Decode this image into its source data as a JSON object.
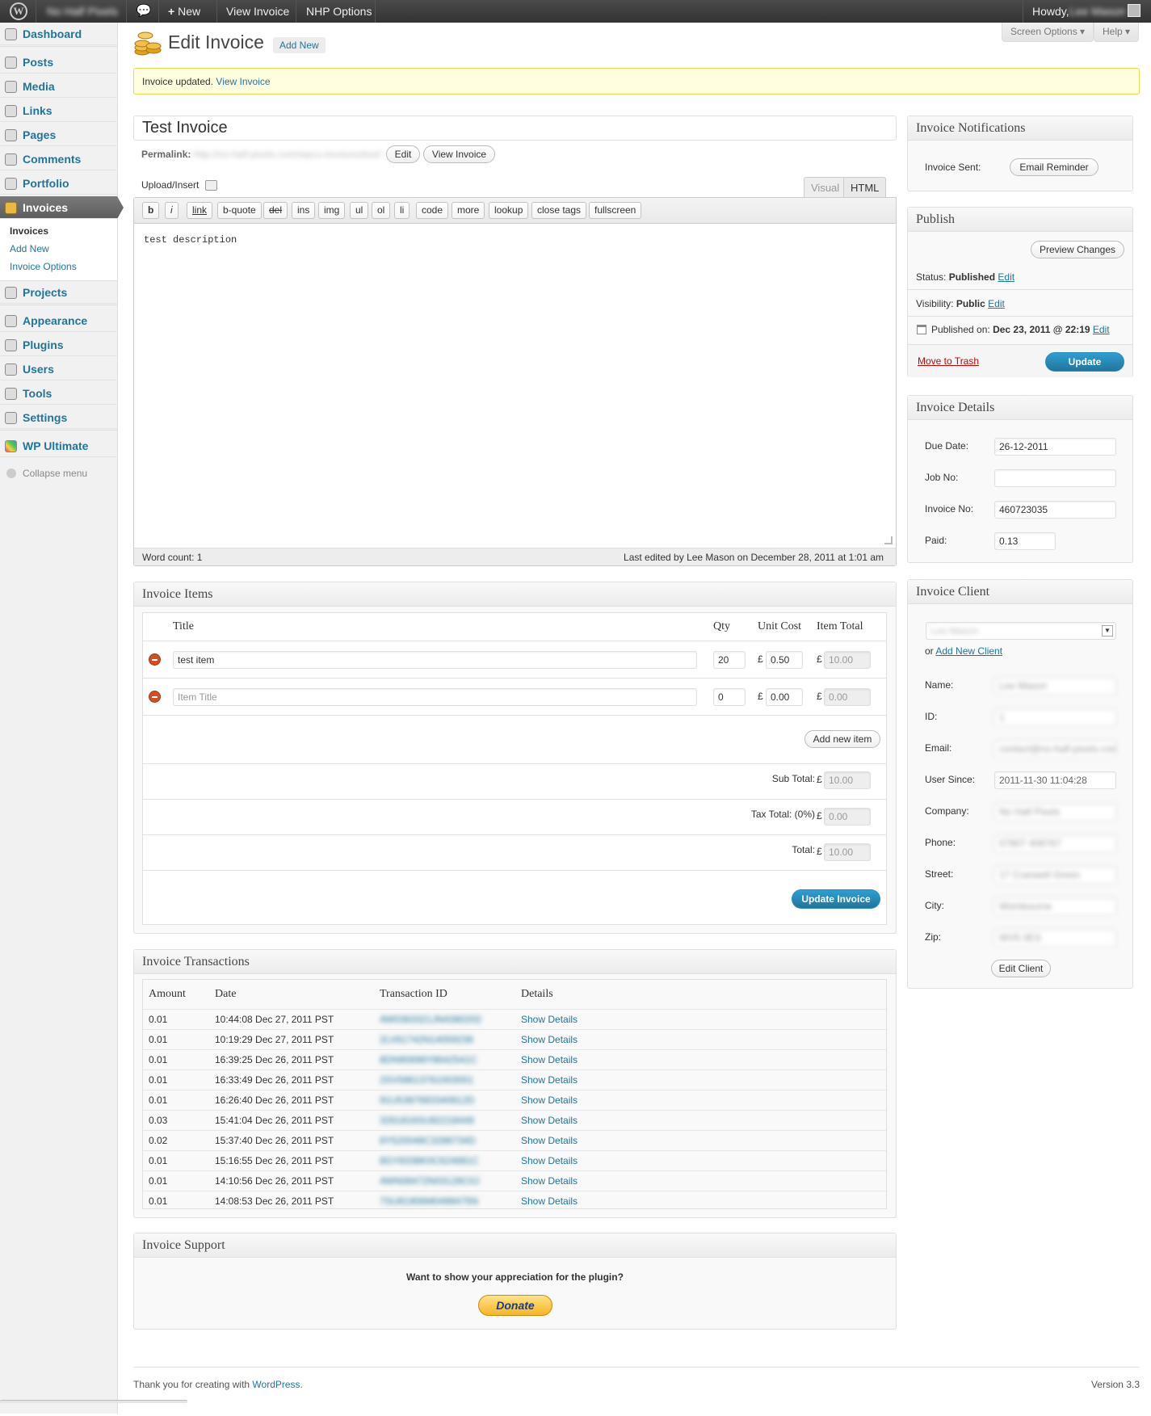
{
  "adminbar": {
    "site_name": "No Half Pixels",
    "new_label": "New",
    "view_invoice": "View Invoice",
    "nhp_options": "NHP Options",
    "howdy": "Howdy,",
    "user_name": "Lee Mason"
  },
  "sidebar": {
    "items": [
      {
        "label": "Dashboard"
      },
      {
        "label": "Posts"
      },
      {
        "label": "Media"
      },
      {
        "label": "Links"
      },
      {
        "label": "Pages"
      },
      {
        "label": "Comments"
      },
      {
        "label": "Portfolio"
      },
      {
        "label": "Invoices"
      },
      {
        "label": "Projects"
      },
      {
        "label": "Appearance"
      },
      {
        "label": "Plugins"
      },
      {
        "label": "Users"
      },
      {
        "label": "Tools"
      },
      {
        "label": "Settings"
      },
      {
        "label": "WP Ultimate"
      }
    ],
    "submenu": [
      "Invoices",
      "Add New",
      "Invoice Options"
    ],
    "collapse": "Collapse menu"
  },
  "header": {
    "title": "Edit Invoice",
    "add_new": "Add New",
    "screen_options": "Screen Options ▾",
    "help": "Help ▾"
  },
  "notice": {
    "text": "Invoice updated.",
    "link": "View Invoice"
  },
  "post": {
    "title": "Test Invoice",
    "permalink_label": "Permalink:",
    "permalink_url": "http://no-half-pixels.com/wpcu-invoices/test/",
    "edit_btn": "Edit",
    "view_btn": "View Invoice",
    "upload_insert": "Upload/Insert",
    "tab_visual": "Visual",
    "tab_html": "HTML",
    "quicktags": [
      "b",
      "i",
      "link",
      "b-quote",
      "del",
      "ins",
      "img",
      "ul",
      "ol",
      "li",
      "code",
      "more",
      "lookup",
      "close tags",
      "fullscreen"
    ],
    "content": "test description",
    "word_count": "Word count: 1",
    "last_edited": "Last edited by Lee Mason on December 28, 2011 at 1:01 am"
  },
  "invoice_items": {
    "heading": "Invoice Items",
    "col_title": "Title",
    "col_qty": "Qty",
    "col_unit": "Unit Cost",
    "col_total": "Item Total",
    "currency": "£",
    "rows": [
      {
        "title": "test item",
        "placeholder": "",
        "qty": "20",
        "unit": "0.50",
        "total": "10.00"
      },
      {
        "title": "",
        "placeholder": "Item Title",
        "qty": "0",
        "unit": "0.00",
        "total": "0.00"
      }
    ],
    "add_item": "Add new item",
    "sub_total_label": "Sub Total:",
    "sub_total": "10.00",
    "tax_label": "Tax Total: (0%)",
    "tax": "0.00",
    "total_label": "Total:",
    "total": "10.00",
    "update_btn": "Update Invoice"
  },
  "transactions": {
    "heading": "Invoice Transactions",
    "col_amount": "Amount",
    "col_date": "Date",
    "col_txid": "Transaction ID",
    "col_details": "Details",
    "details_link": "Show Details",
    "rows": [
      {
        "amount": "0.01",
        "date": "10:44:08 Dec 27, 2011 PST",
        "txid": "4W0363321JN4380202"
      },
      {
        "amount": "0.01",
        "date": "10:19:29 Dec 27, 2011 PST",
        "txid": "2LV61742N14059236"
      },
      {
        "amount": "0.01",
        "date": "16:39:25 Dec 26, 2011 PST",
        "txid": "8DN90698Y8642541C"
      },
      {
        "amount": "0.01",
        "date": "16:33:49 Dec 26, 2011 PST",
        "txid": "2SV58613761003001"
      },
      {
        "amount": "0.01",
        "date": "16:26:40 Dec 26, 2011 PST",
        "txid": "91U5387683340812D"
      },
      {
        "amount": "0.03",
        "date": "15:41:04 Dec 26, 2011 PST",
        "txid": "3261816SU82218449"
      },
      {
        "amount": "0.02",
        "date": "15:37:40 Dec 26, 2011 PST",
        "txid": "8Y520048C3288734D"
      },
      {
        "amount": "0.01",
        "date": "15:16:55 Dec 26, 2011 PST",
        "txid": "8GY8338K0C624681C"
      },
      {
        "amount": "0.01",
        "date": "14:10:56 Dec 26, 2011 PST",
        "txid": "4WN08472N03128C0J"
      },
      {
        "amount": "0.01",
        "date": "14:08:53 Dec 26, 2011 PST",
        "txid": "7SU81906M0498475N"
      }
    ]
  },
  "support": {
    "heading": "Invoice Support",
    "question": "Want to show your appreciation for the plugin?",
    "donate": "Donate"
  },
  "notifications": {
    "heading": "Invoice Notifications",
    "sent_label": "Invoice Sent:",
    "reminder_btn": "Email Reminder"
  },
  "publish": {
    "heading": "Publish",
    "preview_btn": "Preview Changes",
    "status_label": "Status:",
    "status_value": "Published",
    "visibility_label": "Visibility:",
    "visibility_value": "Public",
    "published_label": "Published on:",
    "published_value": "Dec 23, 2011 @ 22:19",
    "edit": "Edit",
    "trash": "Move to Trash",
    "update_btn": "Update"
  },
  "details": {
    "heading": "Invoice Details",
    "due_label": "Due Date:",
    "due_value": "26-12-2011",
    "job_label": "Job No:",
    "job_value": "",
    "invoice_label": "Invoice No:",
    "invoice_value": "460723035",
    "paid_label": "Paid:",
    "paid_value": "0.13"
  },
  "client": {
    "heading": "Invoice Client",
    "selected": "Lee Mason",
    "or": "or",
    "add_new": "Add New Client",
    "fields": [
      {
        "label": "Name:",
        "value": "Lee Mason"
      },
      {
        "label": "ID:",
        "value": "1"
      },
      {
        "label": "Email:",
        "value": "contact@no-half-pixels.com"
      },
      {
        "label": "User Since:",
        "value": "2011-11-30 11:04:28"
      },
      {
        "label": "Company:",
        "value": "No Half Pixels"
      },
      {
        "label": "Phone:",
        "value": "07807 408767"
      },
      {
        "label": "Street:",
        "value": "17 Cranwell Green"
      },
      {
        "label": "City:",
        "value": "Wombourne"
      },
      {
        "label": "Zip:",
        "value": "WV5 0ES"
      }
    ],
    "edit_btn": "Edit Client"
  },
  "footer": {
    "thanks": "Thank you for creating with",
    "wordpress": "WordPress",
    "period": ".",
    "version": "Version 3.3"
  }
}
